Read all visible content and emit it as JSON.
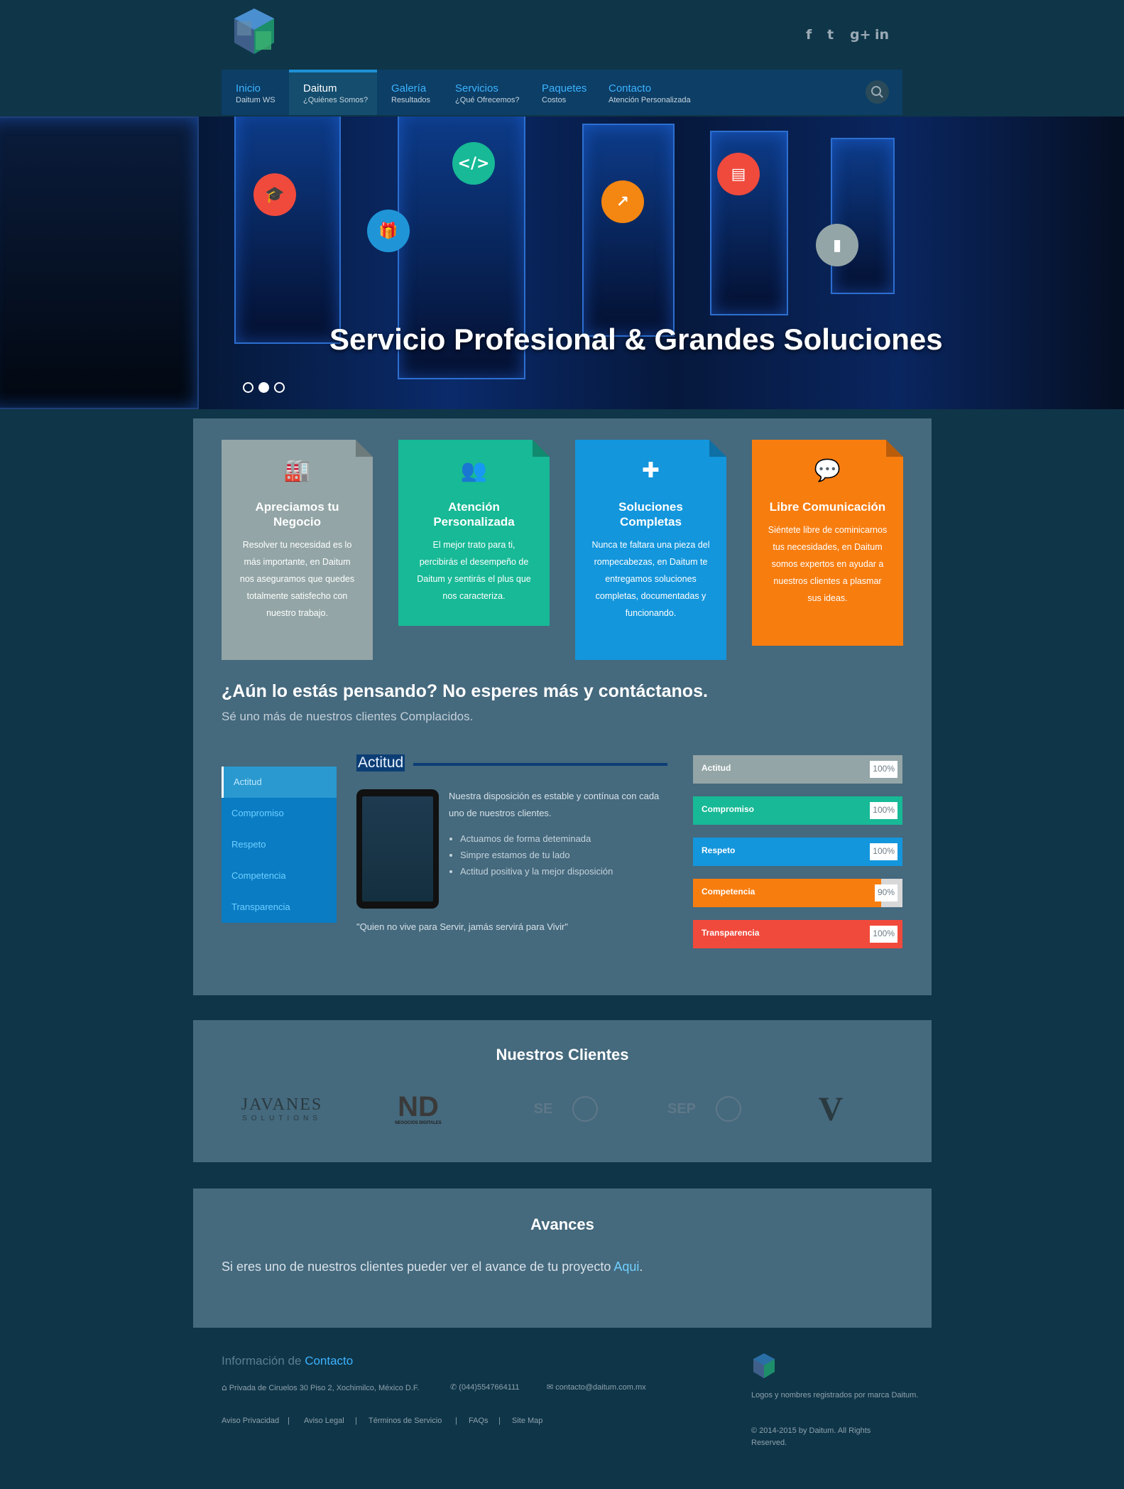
{
  "header": {
    "social": [
      {
        "name": "facebook",
        "glyph": "f"
      },
      {
        "name": "twitter",
        "glyph": "t"
      },
      {
        "name": "google-plus",
        "glyph": "g+"
      },
      {
        "name": "linkedin",
        "glyph": "in"
      }
    ],
    "nav": [
      {
        "title": "Inicio",
        "subtitle": "Daitum WS",
        "active": false
      },
      {
        "title": "Daitum",
        "subtitle": "¿Quiénes Somos?",
        "active": true
      },
      {
        "title": "Galería",
        "subtitle": "Resultados",
        "active": false
      },
      {
        "title": "Servicios",
        "subtitle": "¿Qué Ofrecemos?",
        "active": false
      },
      {
        "title": "Paquetes",
        "subtitle": "Costos",
        "active": false
      },
      {
        "title": "Contacto",
        "subtitle": "Atención Personalizada",
        "active": false
      }
    ]
  },
  "hero": {
    "title": "Servicio Profesional & Grandes Soluciones",
    "icons": [
      {
        "name": "graduation-cap-icon",
        "glyph": "🎓",
        "color": "#f04a3c"
      },
      {
        "name": "gift-icon",
        "glyph": "🎁",
        "color": "#1f95d8"
      },
      {
        "name": "code-icon",
        "glyph": "</>",
        "color": "#17b996"
      },
      {
        "name": "chart-line-icon",
        "glyph": "↗",
        "color": "#f48612"
      },
      {
        "name": "layout-icon",
        "glyph": "▤",
        "color": "#f04a3c"
      },
      {
        "name": "bar-chart-icon",
        "glyph": "▮",
        "color": "#93a5a6"
      }
    ],
    "slides": 3,
    "active_slide": 1
  },
  "features": [
    {
      "title": "Apreciamos tu Negocio",
      "text": "Resolver tu necesidad es lo más importante, en Daitum nos aseguramos que quedes totalmente satisfecho con nuestro trabajo.",
      "color": "#93a5a6",
      "icon": "factory-icon",
      "glyph": "🏭"
    },
    {
      "title": "Atención Personalizada",
      "text": "El mejor trato para ti, percibirás el desempeño de Daitum y sentirás el plus que nos caracteriza.",
      "color": "#17b996",
      "icon": "users-icon",
      "glyph": "👥"
    },
    {
      "title": "Soluciones Completas",
      "text": "Nunca te faltara una pieza del rompecabezas, en Daitum te entregamos soluciones completas, documentadas y funcionando.",
      "color": "#1396dc",
      "icon": "puzzle-icon",
      "glyph": "✚"
    },
    {
      "title": "Libre Comunicación",
      "text": "Siéntete libre de cominicarnos tus necesidades, en Daitum somos expertos en ayudar a nuestros clientes a plasmar sus ideas.",
      "color": "#f87d0f",
      "icon": "chat-icon",
      "glyph": "💬"
    }
  ],
  "cta": {
    "title": "¿Aún lo estás pensando? No esperes más y contáctanos.",
    "subtitle": "Sé uno más de nuestros clientes Complacidos."
  },
  "tabs": {
    "items": [
      "Actitud",
      "Compromiso",
      "Respeto",
      "Competencia",
      "Transparencia"
    ],
    "active": 0,
    "heading": "Actitud",
    "description": "Nuestra disposición es estable y contínua con cada uno de nuestros clientes.",
    "bullets": [
      "Actuamos de forma deteminada",
      "Simpre estamos de tu lado",
      "Actitud positiva y la mejor disposición"
    ],
    "quote": "\"Quien no vive para Servir, jamás servirá para Vivir\""
  },
  "skills": [
    {
      "label": "Actitud",
      "value": 100,
      "pct_text": "100%",
      "color": "#93a5a6"
    },
    {
      "label": "Compromiso",
      "value": 100,
      "pct_text": "100%",
      "color": "#17b996"
    },
    {
      "label": "Respeto",
      "value": 100,
      "pct_text": "100%",
      "color": "#1396dc"
    },
    {
      "label": "Competencia",
      "value": 90,
      "pct_text": "90%",
      "color": "#f87d0f"
    },
    {
      "label": "Transparencia",
      "value": 100,
      "pct_text": "100%",
      "color": "#f04a3c"
    }
  ],
  "clients": {
    "title": "Nuestros Clientes",
    "logos": [
      {
        "name": "javanes-solutions-logo",
        "text": "JAVANES",
        "sub": "SOLUTIONS"
      },
      {
        "name": "nd-logo",
        "text": "ND",
        "sub": "NEGOCIOS DIGITALES"
      },
      {
        "name": "se-logo",
        "text": "SE",
        "sub": ""
      },
      {
        "name": "sep-logo",
        "text": "SEP",
        "sub": ""
      },
      {
        "name": "v-logo",
        "text": "V",
        "sub": ""
      }
    ]
  },
  "avances": {
    "title": "Avances",
    "text_before": "Si eres uno de nuestros clientes pueder ver el avance de tu proyecto ",
    "link": "Aqui",
    "text_after": "."
  },
  "footer": {
    "title_prefix": "Información de",
    "title_highlight": "Contacto",
    "address": "Privada de Ciruelos 30 Piso 2, Xochimilco, México D.F.",
    "phone": "(044)5547664111",
    "email": "contacto@daitum.com.mx",
    "links": [
      "Aviso Privacidad",
      "Aviso Legal",
      "Términos de Servicio",
      "FAQs",
      "Site Map"
    ],
    "separator": "|",
    "brand_text": "Logos y nombres registrados por marca Daitum.",
    "copyright": "© 2014-2015 by Daitum. All Rights Reserved."
  }
}
